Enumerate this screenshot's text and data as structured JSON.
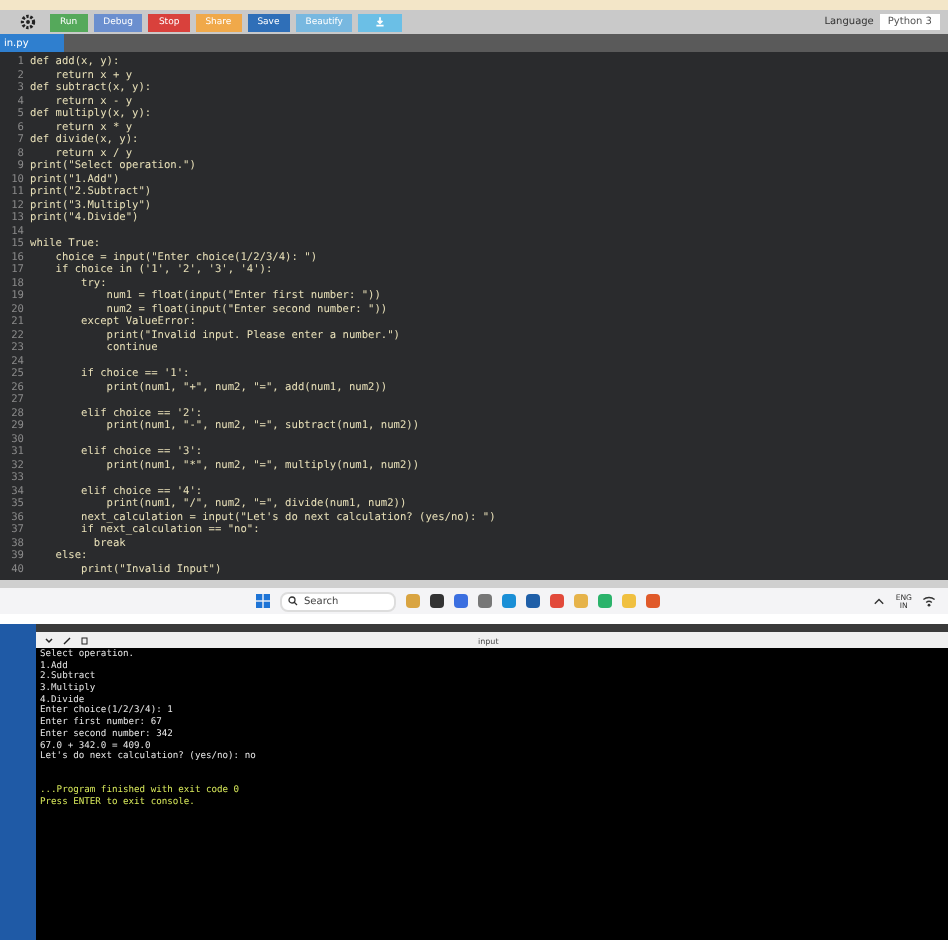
{
  "toolbar": {
    "buttons": [
      {
        "label": "Run",
        "kind": "run"
      },
      {
        "label": "Debug",
        "kind": "debug"
      },
      {
        "label": "Stop",
        "kind": "stop"
      },
      {
        "label": "Share",
        "kind": "share"
      },
      {
        "label": "Save",
        "kind": "save"
      },
      {
        "label": "Beautify",
        "kind": "beautify"
      },
      {
        "kind": "download"
      }
    ],
    "language_label": "Language",
    "language": "Python 3"
  },
  "file_tab": "in.py",
  "code": [
    {
      "number": "1",
      "text": "def add(x, y):"
    },
    {
      "number": "2",
      "text": "    return x + y"
    },
    {
      "number": "3",
      "text": "def subtract(x, y):"
    },
    {
      "number": "4",
      "text": "    return x - y"
    },
    {
      "number": "5",
      "text": "def multiply(x, y):"
    },
    {
      "number": "6",
      "text": "    return x * y"
    },
    {
      "number": "7",
      "text": "def divide(x, y):"
    },
    {
      "number": "8",
      "text": "    return x / y"
    },
    {
      "number": "9",
      "text": "print(\"Select operation.\")"
    },
    {
      "number": "10",
      "text": "print(\"1.Add\")"
    },
    {
      "number": "11",
      "text": "print(\"2.Subtract\")"
    },
    {
      "number": "12",
      "text": "print(\"3.Multiply\")"
    },
    {
      "number": "13",
      "text": "print(\"4.Divide\")"
    },
    {
      "number": "14"
    },
    {
      "number": "15",
      "text": "while True:"
    },
    {
      "number": "16",
      "text": "    choice = input(\"Enter choice(1/2/3/4): \")"
    },
    {
      "number": "17",
      "text": "    if choice in ('1', '2', '3', '4'):"
    },
    {
      "number": "18",
      "text": "        try:"
    },
    {
      "number": "19",
      "text": "            num1 = float(input(\"Enter first number: \"))"
    },
    {
      "number": "20",
      "text": "            num2 = float(input(\"Enter second number: \"))"
    },
    {
      "number": "21",
      "text": "        except ValueError:"
    },
    {
      "number": "22",
      "text": "            print(\"Invalid input. Please enter a number.\")"
    },
    {
      "number": "23",
      "text": "            continue"
    },
    {
      "number": "24"
    },
    {
      "number": "25",
      "text": "        if choice == '1':"
    },
    {
      "number": "26",
      "text": "            print(num1, \"+\", num2, \"=\", add(num1, num2))"
    },
    {
      "number": "27"
    },
    {
      "number": "28",
      "text": "        elif choice == '2':"
    },
    {
      "number": "29",
      "text": "            print(num1, \"-\", num2, \"=\", subtract(num1, num2))"
    },
    {
      "number": "30"
    },
    {
      "number": "31",
      "text": "        elif choice == '3':"
    },
    {
      "number": "32",
      "text": "            print(num1, \"*\", num2, \"=\", multiply(num1, num2))"
    },
    {
      "number": "33"
    },
    {
      "number": "34",
      "text": "        elif choice == '4':"
    },
    {
      "number": "35",
      "text": "            print(num1, \"/\", num2, \"=\", divide(num1, num2))"
    },
    {
      "number": "36",
      "text": "        next_calculation = input(\"Let's do next calculation? (yes/no): \")"
    },
    {
      "number": "37",
      "text": "        if next_calculation == \"no\":"
    },
    {
      "number": "38",
      "text": "          break"
    },
    {
      "number": "39",
      "text": "    else:"
    },
    {
      "number": "40",
      "text": "        print(\"Invalid Input\")"
    }
  ],
  "taskbar": {
    "search_placeholder": "Search",
    "language": "ENG",
    "region": "IN"
  },
  "console": {
    "title": "input",
    "lines": [
      {
        "text": "Select operation.",
        "kind": "out"
      },
      {
        "text": "1.Add",
        "kind": "out"
      },
      {
        "text": "2.Subtract",
        "kind": "out"
      },
      {
        "text": "3.Multiply",
        "kind": "out"
      },
      {
        "text": "4.Divide",
        "kind": "out"
      },
      {
        "text": "Enter choice(1/2/3/4): 1",
        "kind": "out"
      },
      {
        "text": "Enter first number: 67",
        "kind": "out"
      },
      {
        "text": "Enter second number: 342",
        "kind": "out"
      },
      {
        "text": "67.0 + 342.0 = 409.0",
        "kind": "out"
      },
      {
        "text": "Let's do next calculation? (yes/no): no",
        "kind": "out"
      },
      {
        "text": "...Program finished with exit code 0",
        "kind": "status"
      },
      {
        "text": "Press ENTER to exit console.",
        "kind": "status"
      }
    ]
  }
}
